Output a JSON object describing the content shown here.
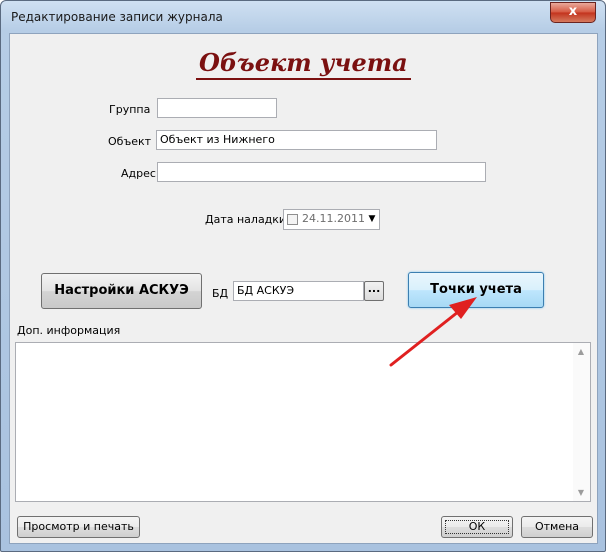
{
  "window": {
    "title": "Редактирование записи журнала",
    "close_symbol": "x"
  },
  "form": {
    "heading": "Объект учета",
    "group": {
      "label": "Группа",
      "value": ""
    },
    "object": {
      "label": "Объект",
      "value": "Объект из Нижнего"
    },
    "address": {
      "label": "Адрес",
      "value": ""
    },
    "setup_date": {
      "label": "Дата наладки",
      "value": "24.11.2011",
      "checked": false,
      "dropdown_symbol": "▼"
    }
  },
  "actions": {
    "settings_label": "Настройки АСКУЭ",
    "db_label": "БД",
    "db_value": "БД АСКУЭ",
    "browse_label": "...",
    "points_label": "Точки учета"
  },
  "extra": {
    "label": "Доп. информация",
    "value": "",
    "scroll_up": "▲",
    "scroll_down": "▼"
  },
  "footer": {
    "preview_label": "Просмотр и печать",
    "ok_label": "ОК",
    "cancel_label": "Отмена"
  },
  "colors": {
    "heading": "#7b1010",
    "annotation_arrow": "#e02020",
    "highlight_button": "#bee6fd"
  }
}
